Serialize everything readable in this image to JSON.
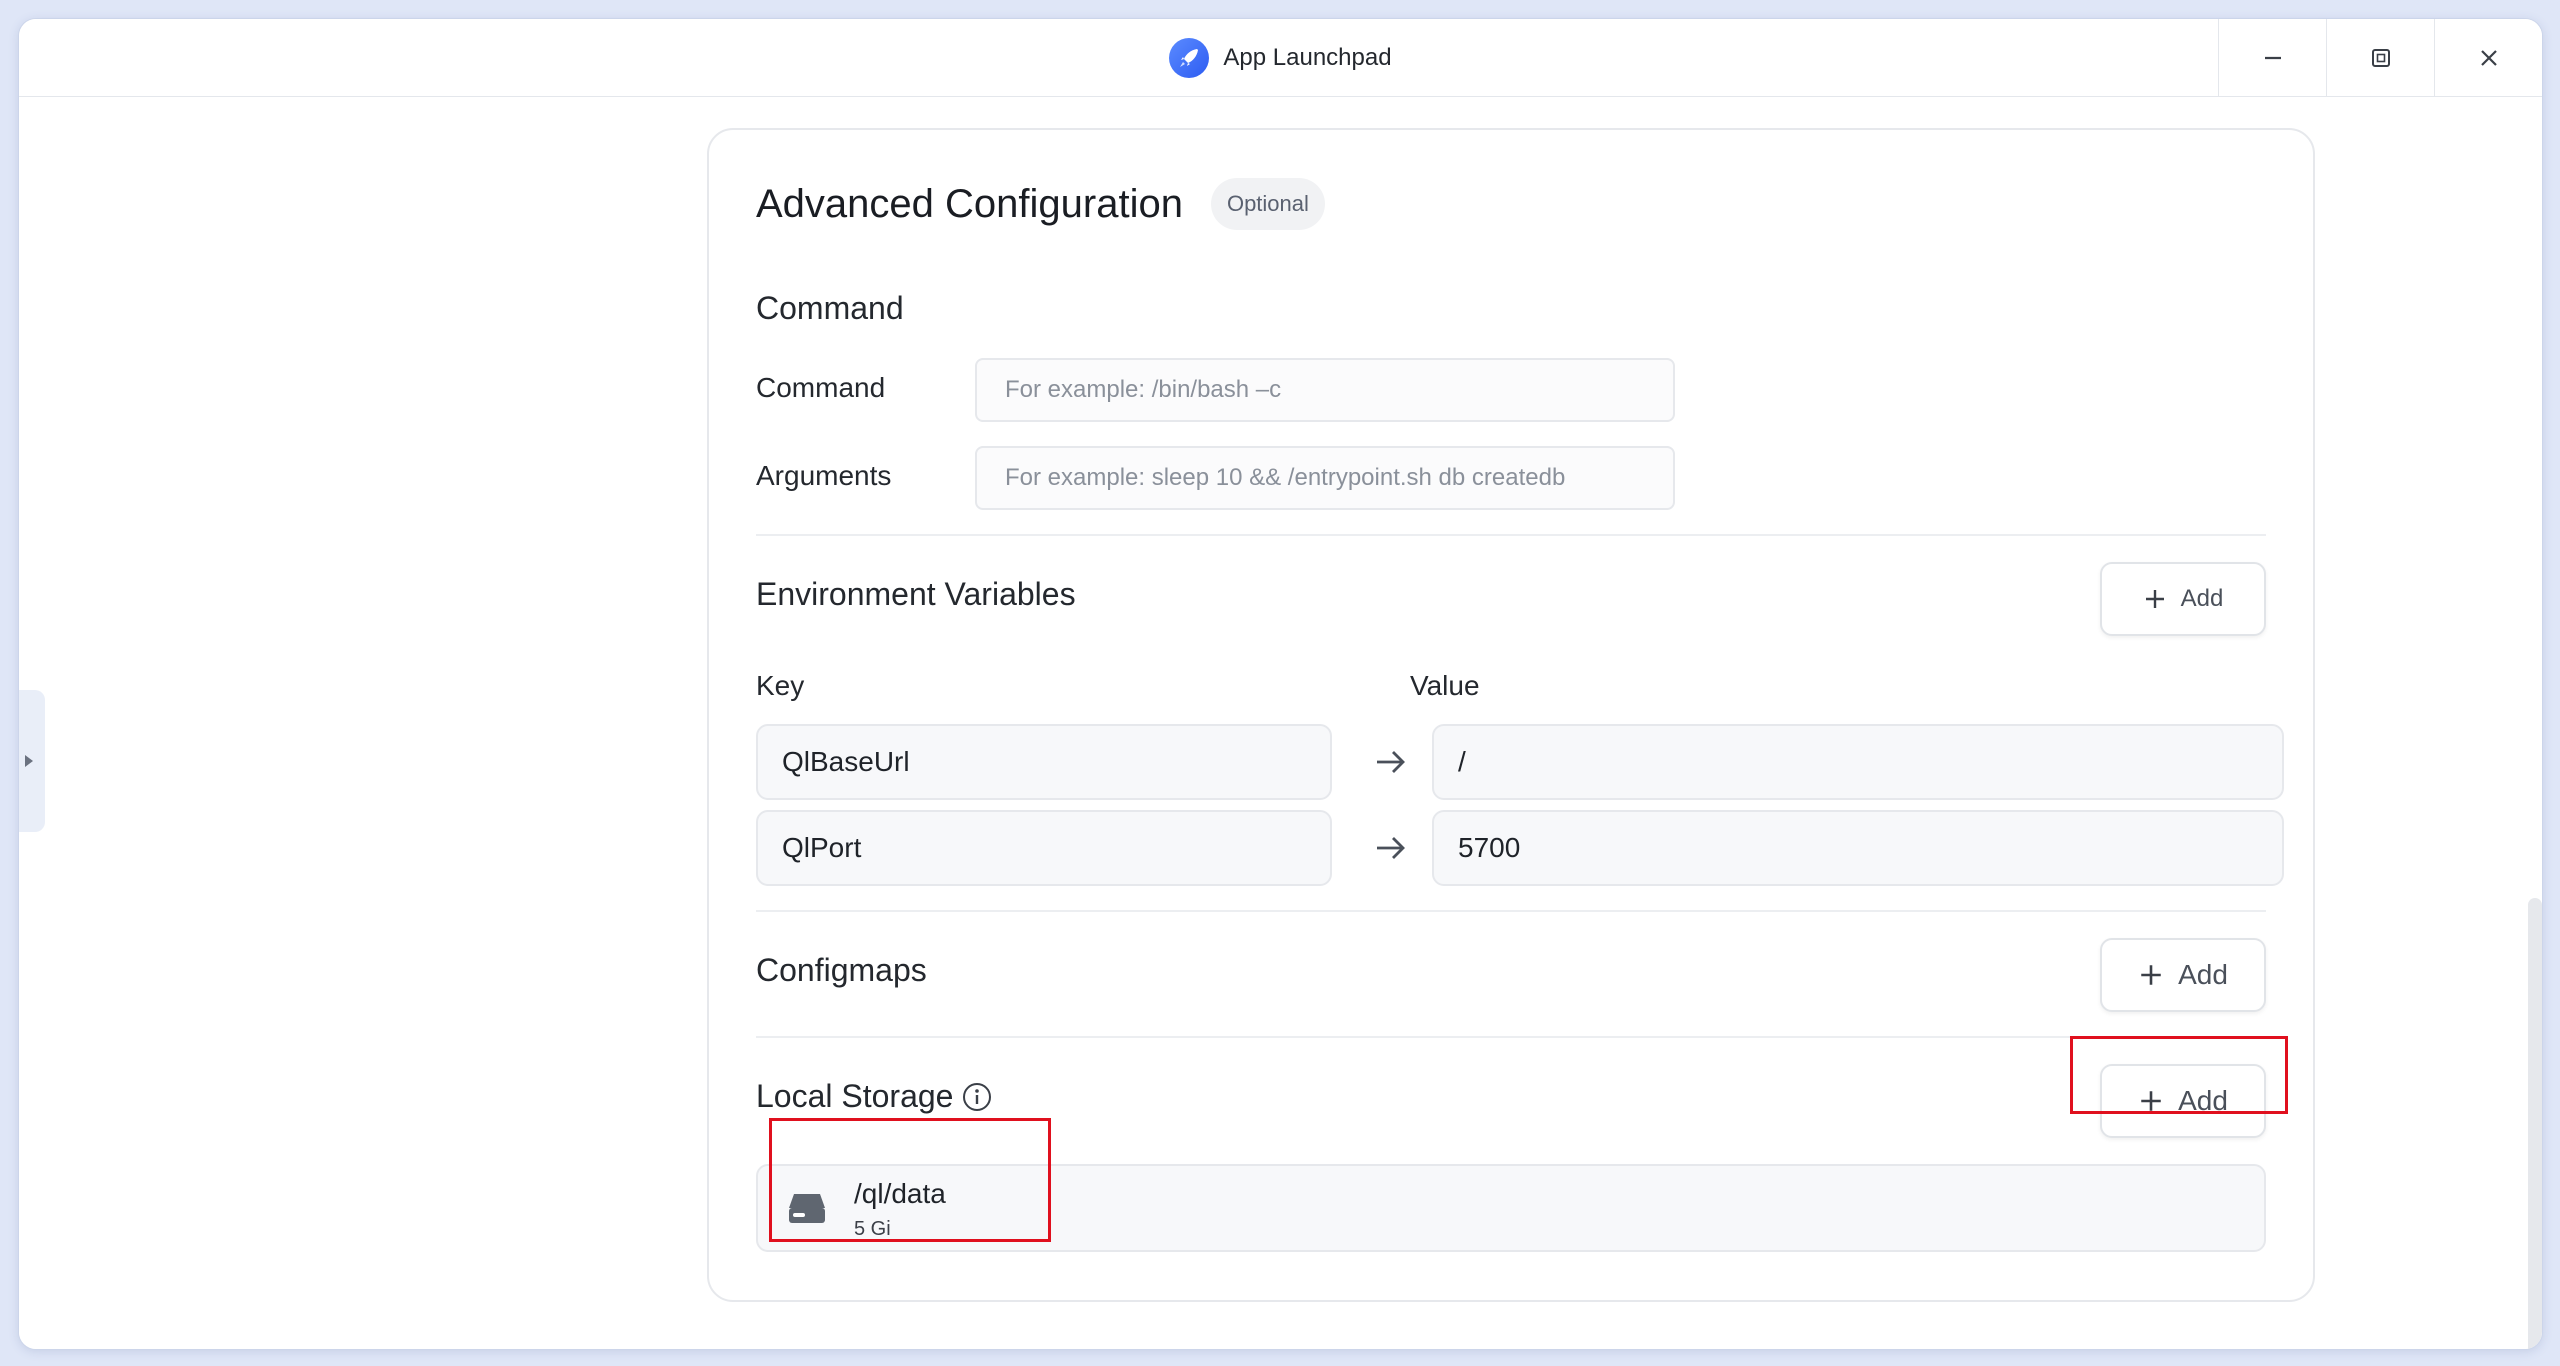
{
  "window": {
    "title": "App Launchpad"
  },
  "card": {
    "title": "Advanced Configuration",
    "badge": "Optional"
  },
  "command_section": {
    "heading": "Command",
    "command_label": "Command",
    "command_placeholder": "For example:  /bin/bash –c",
    "arguments_label": "Arguments",
    "arguments_placeholder": "For example:  sleep 10 && /entrypoint.sh db createdb"
  },
  "env_section": {
    "heading": "Environment Variables",
    "add_label": "Add",
    "key_label": "Key",
    "value_label": "Value",
    "rows": [
      {
        "key": "QlBaseUrl",
        "value": "/"
      },
      {
        "key": "QlPort",
        "value": "5700"
      }
    ]
  },
  "configmaps_section": {
    "heading": "Configmaps",
    "add_label": "Add"
  },
  "storage_section": {
    "heading": "Local Storage",
    "add_label": "Add",
    "items": [
      {
        "path": "/ql/data",
        "size": "5 Gi",
        "icon": "disk-icon"
      }
    ]
  },
  "colors": {
    "accent": "#2d5cf2",
    "highlight": "#e0101e",
    "background": "#dfe6f7"
  }
}
